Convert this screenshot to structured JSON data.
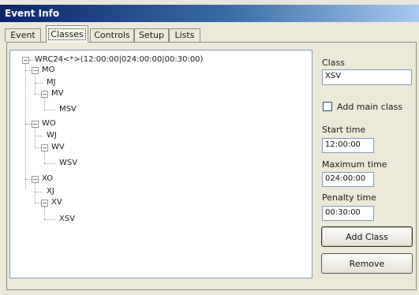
{
  "window": {
    "title": "Event Info"
  },
  "tabs": [
    {
      "label": "Event"
    },
    {
      "label": "Classes",
      "active": true
    },
    {
      "label": "Controls"
    },
    {
      "label": "Setup"
    },
    {
      "label": "Lists"
    }
  ],
  "tree": {
    "root": "WRC24<*>(12:00:00|024:00:00|00:30:00)",
    "nodes": [
      "MO",
      "MJ",
      "MV",
      "MSV",
      "WO",
      "WJ",
      "WV",
      "WSV",
      "XO",
      "XJ",
      "XV",
      "XSV"
    ]
  },
  "form": {
    "class_label": "Class",
    "class_value": "XSV",
    "add_main_class_label": "Add main class",
    "add_main_class_checked": false,
    "start_time_label": "Start time",
    "start_time_value": "12:00:00",
    "max_time_label": "Maximum time",
    "max_time_value": "024:00:00",
    "penalty_time_label": "Penalty time",
    "penalty_time_value": "00:30:00"
  },
  "buttons": {
    "add_class": "Add Class",
    "remove": "Remove"
  },
  "icons": {
    "expand": "minus-box-icon"
  }
}
